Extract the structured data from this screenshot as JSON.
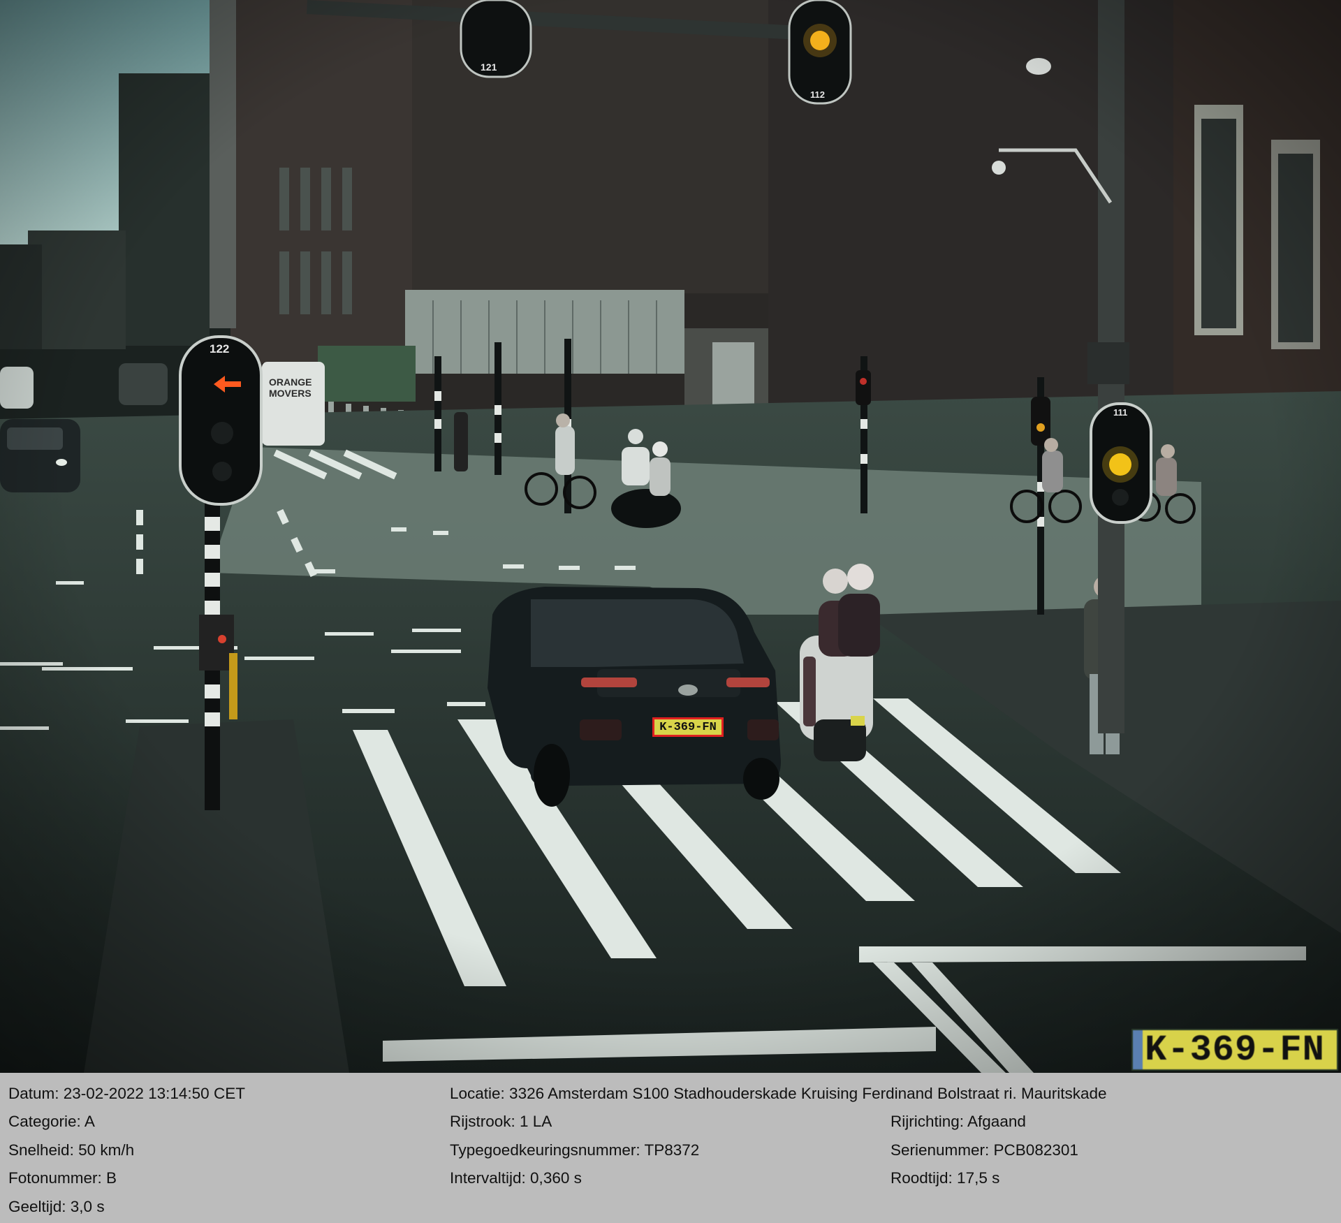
{
  "photo": {
    "signals": {
      "left": "122",
      "top_left": "121",
      "top_right": "112",
      "right": "111"
    },
    "plate": "K-369-FN",
    "plate_crop": "K-369-FN",
    "van_text": "ORANGE MOVERS"
  },
  "info": {
    "datum": "Datum: 23-02-2022 13:14:50 CET",
    "locatie": "Locatie: 3326 Amsterdam S100 Stadhouderskade Kruising Ferdinand Bolstraat ri. Mauritskade",
    "categorie": "Categorie: A",
    "rijstrook": "Rijstrook: 1 LA",
    "rijrichting": "Rijrichting: Afgaand",
    "snelheid": "Snelheid: 50 km/h",
    "typegoedkeuring": "Typegoedkeuringsnummer: TP8372",
    "serienummer": "Serienummer: PCB082301",
    "fotonummer": "Fotonummer: B",
    "intervaltijd": "Intervaltijd: 0,360 s",
    "roodtijd": "Roodtijd: 17,5 s",
    "geeltijd": "Geeltijd: 3,0 s"
  }
}
